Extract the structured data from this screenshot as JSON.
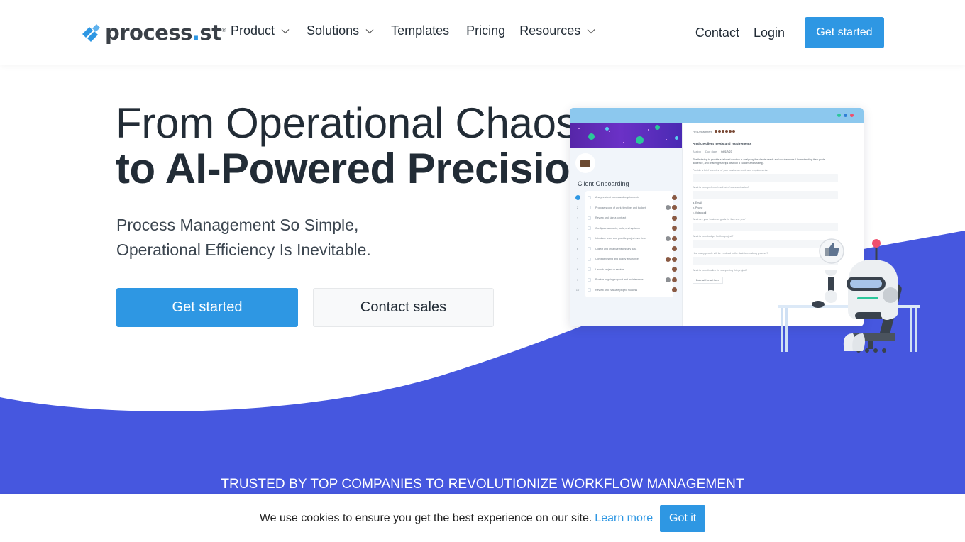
{
  "brand": {
    "name_main": "process",
    "name_dot": ".",
    "name_tail": "st",
    "registered": "®",
    "accent": "#2e97e3",
    "wave_color": "#4657df"
  },
  "nav": {
    "items": [
      {
        "label": "Product",
        "has_dropdown": true
      },
      {
        "label": "Solutions",
        "has_dropdown": true
      },
      {
        "label": "Templates",
        "has_dropdown": false
      },
      {
        "label": "Pricing",
        "has_dropdown": false
      },
      {
        "label": "Resources",
        "has_dropdown": true
      }
    ],
    "contact": "Contact",
    "login": "Login",
    "cta": "Get started"
  },
  "hero": {
    "title_line1": "From Operational Chaos",
    "title_line2": "to AI-Powered Precision",
    "subtitle_line1": "Process Management So Simple,",
    "subtitle_line2": "Operational Efficiency Is Inevitable.",
    "primary_cta": "Get started",
    "secondary_cta": "Contact sales"
  },
  "mockup": {
    "checklist_title": "Client Onboarding",
    "tasks": [
      {
        "num": "1",
        "label": "Analyze client needs and requirements",
        "active": true
      },
      {
        "num": "2",
        "label": "Propose scope of work, timeline, and budget"
      },
      {
        "num": "3",
        "label": "Review and sign a contract"
      },
      {
        "num": "4",
        "label": "Configure accounts, tools, and systems"
      },
      {
        "num": "5",
        "label": "Introduce team and provide project overview"
      },
      {
        "num": "6",
        "label": "Collect and organize necessary data"
      },
      {
        "num": "7",
        "label": "Conduct testing and quality assurance"
      },
      {
        "num": "8",
        "label": "Launch project or service"
      },
      {
        "num": "9",
        "label": "Provide ongoing support and maintenance"
      },
      {
        "num": "10",
        "label": "Review and evaluate project success"
      }
    ],
    "detail": {
      "department": "HR Department",
      "task_title": "Analyze client needs and requirements",
      "assign_label": "Assign",
      "due_label": "Due date",
      "due_value": "04/17/23",
      "description": "The first step to provide a tailored solution is analyzing the clients needs and requirements. Understanding their goals, audience, and challenges helps develop a customized strategy.",
      "q1": "Provide a brief overview of your business needs and requirements.",
      "q2": "What is your preferred method of communication?",
      "options": [
        "a. Email",
        "b. Phone",
        "c. Video call"
      ],
      "q3": "What are your business goals for the next year?",
      "q4": "What is your budget for this project?",
      "q5": "How many people will be involved in the decision-making process?",
      "q6": "What is your timeline for completing this project?",
      "date_placeholder": "Date will be set here"
    }
  },
  "trusted_heading": "TRUSTED BY TOP COMPANIES TO REVOLUTIONIZE WORKFLOW MANAGEMENT",
  "cookie": {
    "message": "We use cookies to ensure you get the best experience on our site.",
    "learn_more": "Learn more",
    "accept": "Got it"
  }
}
